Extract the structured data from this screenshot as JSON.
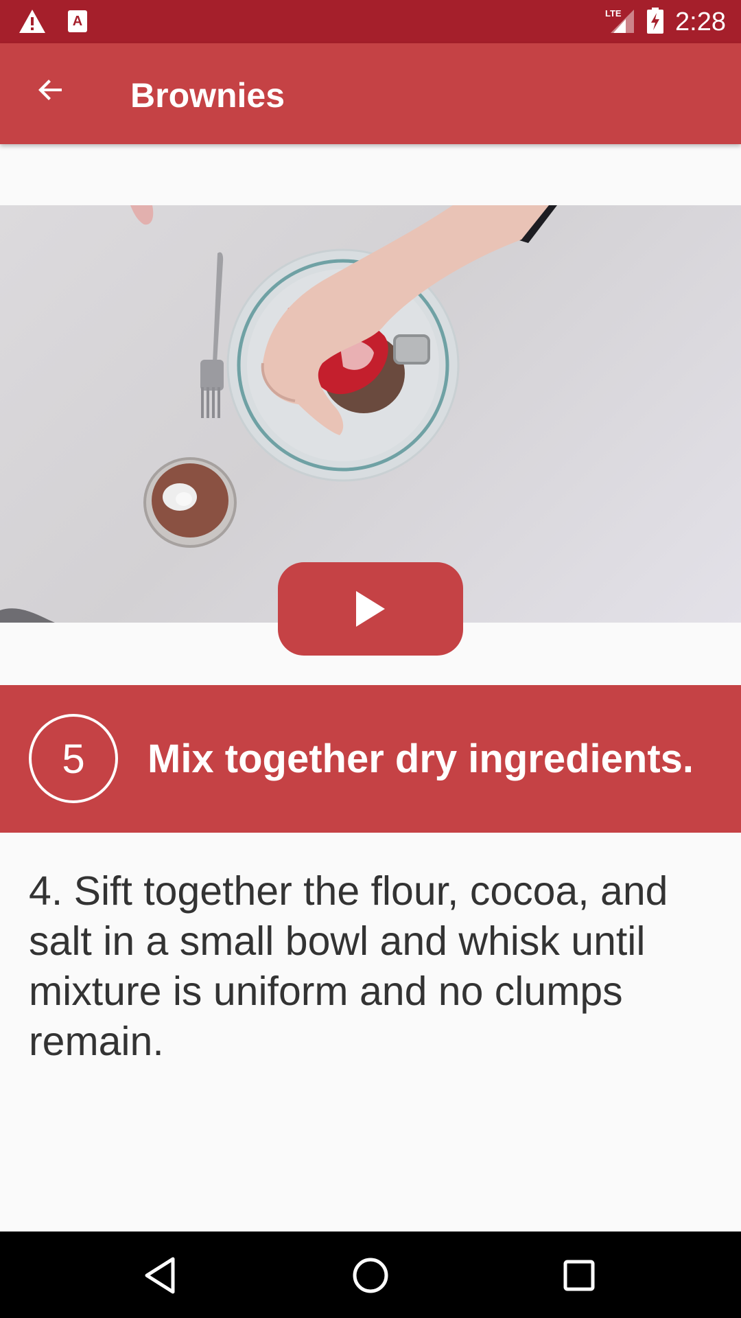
{
  "status_bar": {
    "time": "2:28",
    "network": "LTE",
    "icons": [
      "warning-icon",
      "app-notification-icon",
      "signal-icon",
      "battery-charging-icon"
    ]
  },
  "app_bar": {
    "title": "Brownies",
    "back_icon": "arrow-back-icon"
  },
  "video": {
    "play_icon": "play-icon"
  },
  "step": {
    "number": "5",
    "title": "Mix together dry ingredients."
  },
  "instruction": {
    "text": "4. Sift together the flour, cocoa, and salt in a small bowl and whisk until mixture is uniform and no clumps remain."
  },
  "nav_bar": {
    "icons": [
      "nav-back-icon",
      "nav-home-icon",
      "nav-recents-icon"
    ]
  },
  "colors": {
    "status_bar": "#a51f2b",
    "primary": "#c54245",
    "background": "#fafafa",
    "text": "#333333"
  }
}
